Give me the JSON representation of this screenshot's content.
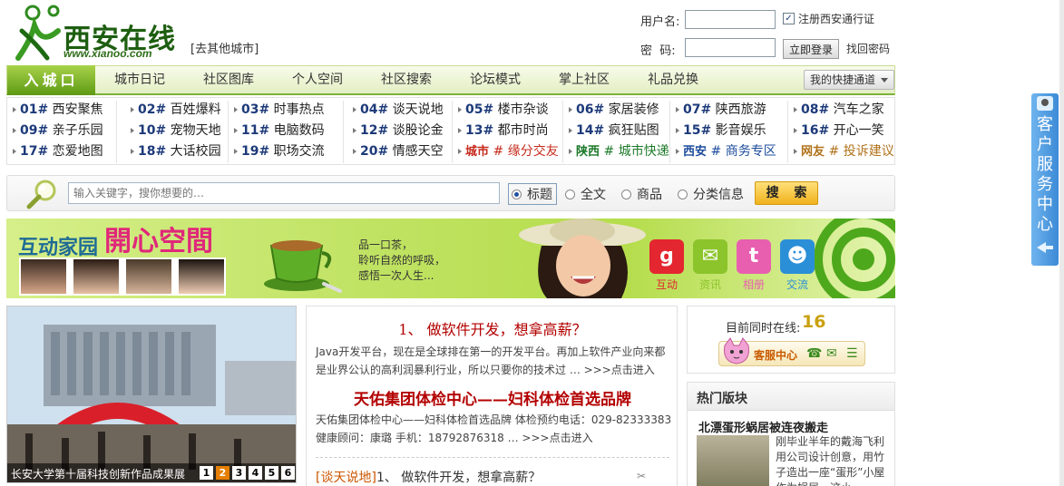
{
  "header": {
    "logo_text": "西安在线",
    "logo_url": "www.xianoo.com",
    "city_link": "[去其他城市]",
    "login": {
      "username_label": "用户名:",
      "password_label": "密  码:",
      "register_label": "注册西安通行证",
      "login_button": "立即登录",
      "forgot_link": "找回密码"
    }
  },
  "nav": {
    "home": "入城口",
    "items": [
      "城市日记",
      "社区图库",
      "个人空间",
      "社区搜索",
      "论坛模式",
      "掌上社区",
      "礼品兑换"
    ],
    "quick": "我的快捷通道"
  },
  "forums": {
    "rows": [
      [
        [
          "01#",
          "西安聚焦"
        ],
        [
          "02#",
          "百姓爆料"
        ],
        [
          "03#",
          "时事热点"
        ],
        [
          "04#",
          "谈天说地"
        ],
        [
          "05#",
          "楼市杂谈"
        ],
        [
          "06#",
          "家居装修"
        ],
        [
          "07#",
          "陕西旅游"
        ],
        [
          "08#",
          "汽车之家"
        ]
      ],
      [
        [
          "09#",
          "亲子乐园"
        ],
        [
          "10#",
          "宠物天地"
        ],
        [
          "11#",
          "电脑数码"
        ],
        [
          "12#",
          "谈股论金"
        ],
        [
          "13#",
          "都市时尚"
        ],
        [
          "14#",
          "疯狂贴图"
        ],
        [
          "15#",
          "影音娱乐"
        ],
        [
          "16#",
          "开心一笑"
        ]
      ],
      [
        [
          "17#",
          "恋爱地图"
        ],
        [
          "18#",
          "大话校园"
        ],
        [
          "19#",
          "职场交流"
        ],
        [
          "20#",
          "情感天空"
        ]
      ]
    ],
    "tags": [
      {
        "tag": "城市",
        "name": "# 缘分交友",
        "color": "#c62b1d"
      },
      {
        "tag": "陕西",
        "name": "# 城市快递",
        "color": "#1d7a2a"
      },
      {
        "tag": "西安",
        "name": "# 商务专区",
        "color": "#1c4c9c"
      },
      {
        "tag": "网友",
        "name": "# 投诉建议",
        "color": "#b0721a"
      }
    ]
  },
  "search": {
    "placeholder": "输入关键字，搜你想要的…",
    "options": [
      "标题",
      "全文",
      "商品",
      "分类信息"
    ],
    "selected": "标题",
    "button": "搜 索"
  },
  "banner": {
    "title1": "互动家园",
    "title2": "開心空間",
    "slogan": [
      "品一口茶，",
      "聆听自然的呼吸，",
      "感悟一次人生..."
    ],
    "icons": [
      {
        "label": "互动",
        "icon": "g-icon",
        "color": "#e3262f"
      },
      {
        "label": "资讯",
        "icon": "mail-icon",
        "color": "#8bc42b"
      },
      {
        "label": "相册",
        "icon": "twitter-icon",
        "color": "#e85fb0"
      },
      {
        "label": "交流",
        "icon": "people-icon",
        "color": "#2b8fd8"
      }
    ]
  },
  "photo": {
    "caption": "长安大学第十届科技创新作品成果展",
    "pages": [
      "1",
      "2",
      "3",
      "4",
      "5",
      "6"
    ],
    "current_page": "2"
  },
  "news": {
    "headline1": "1、  做软件开发，想拿高薪？",
    "para1": "Java开发平台，现在是全球排在第一的开发平台。再加上软件产业向来都是业界公认的高利润暴利行业，所以只要你的技术过 … >>>点击进入",
    "headline2": "天佑集团体检中心——妇科体检首选品牌",
    "para2": "天佑集团体检中心——妇科体检首选品牌 体检预约电话：029-82333383 健康顾问：康璐 手机：18792876318 … >>>点击进入",
    "last_category": "[谈天说地]",
    "last_title": "1、  做软件开发，想拿高薪？"
  },
  "online": {
    "label": "目前同时在线:",
    "count": "16",
    "service": "客服中心"
  },
  "hot": {
    "header": "热门版块",
    "title": "北漂蛋形蜗居被连夜搬走",
    "desc": "刚毕业半年的戴海飞利用公司设计创意，用竹子造出一座“蛋形”小屋作为蜗居。这小…"
  },
  "sidetab": {
    "text": "客户服务中心"
  }
}
